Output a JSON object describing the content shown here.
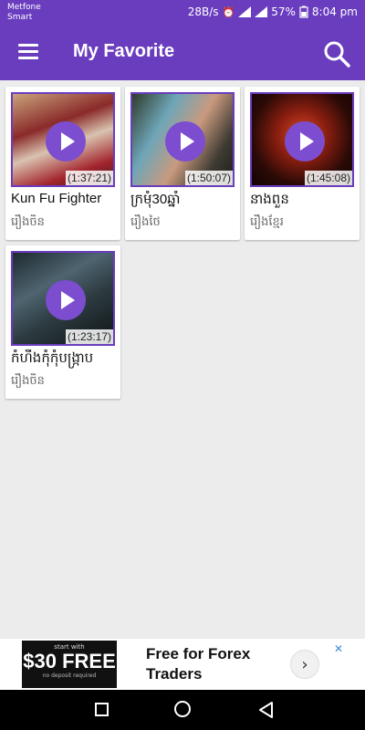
{
  "status_bar": {
    "carrier_line1": "Metfone",
    "carrier_line2": "Smart",
    "net_speed": "28B/s",
    "battery": "57%",
    "time": "8:04 pm"
  },
  "app_bar": {
    "title": "My Favorite"
  },
  "videos": [
    {
      "title": "Kun Fu Fighter",
      "category": "រឿងចិន",
      "duration": "(1:37:21)"
    },
    {
      "title": "ក្រមុំ30ឆ្នាំ",
      "category": "រឿងថៃ",
      "duration": "(1:50:07)"
    },
    {
      "title": "នាងពួន",
      "category": "រឿងខ្មែរ",
      "duration": "(1:45:08)"
    },
    {
      "title": "កំហឹងកុំកុំបង្រ្កាប",
      "category": "រឿងចិន",
      "duration": "(1:23:17)"
    }
  ],
  "ad": {
    "image_top": "start with",
    "image_main": "$30 FREE",
    "image_bottom": "no deposit required",
    "text_line1": "Free for Forex",
    "text_line2": "Traders",
    "close": "✕"
  },
  "colors": {
    "primary": "#6a3dbf",
    "play": "#7c4dcf"
  }
}
